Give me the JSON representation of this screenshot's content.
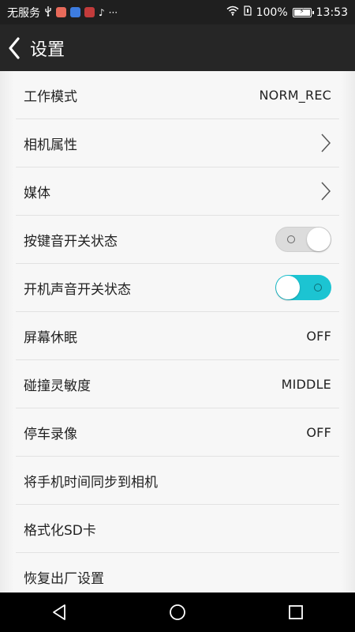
{
  "status_bar": {
    "carrier": "无服务",
    "usb_icon": "usb-icon",
    "apps": [
      "app-icon-1",
      "app-icon-2",
      "app-icon-3",
      "tiktok-icon"
    ],
    "more": "···",
    "wifi_icon": "wifi-icon",
    "sim_icon": "sim-icon",
    "battery": "100%",
    "time": "13:53"
  },
  "header": {
    "title": "设置",
    "back_icon": "back-chevron-icon"
  },
  "settings": [
    {
      "label": "工作模式",
      "value": "NORM_REC",
      "kind": "value"
    },
    {
      "label": "相机属性",
      "kind": "nav"
    },
    {
      "label": "媒体",
      "kind": "nav"
    },
    {
      "label": "按键音开关状态",
      "kind": "toggle",
      "on": false
    },
    {
      "label": "开机声音开关状态",
      "kind": "toggle",
      "on": true
    },
    {
      "label": "屏幕休眠",
      "value": "OFF",
      "kind": "value"
    },
    {
      "label": "碰撞灵敏度",
      "value": "MIDDLE",
      "kind": "value"
    },
    {
      "label": "停车录像",
      "value": "OFF",
      "kind": "value"
    },
    {
      "label": "将手机时间同步到相机",
      "kind": "action"
    },
    {
      "label": "格式化SD卡",
      "kind": "action"
    },
    {
      "label": "恢复出厂设置",
      "kind": "action"
    }
  ],
  "nav_bar": {
    "back_icon": "nav-back-icon",
    "home_icon": "nav-home-icon",
    "recents_icon": "nav-recents-icon"
  },
  "colors": {
    "toggle_on": "#1cc4d2",
    "toggle_off": "#dcdcdc",
    "title_bar": "#262626",
    "status_bar": "#1f1f1f"
  }
}
